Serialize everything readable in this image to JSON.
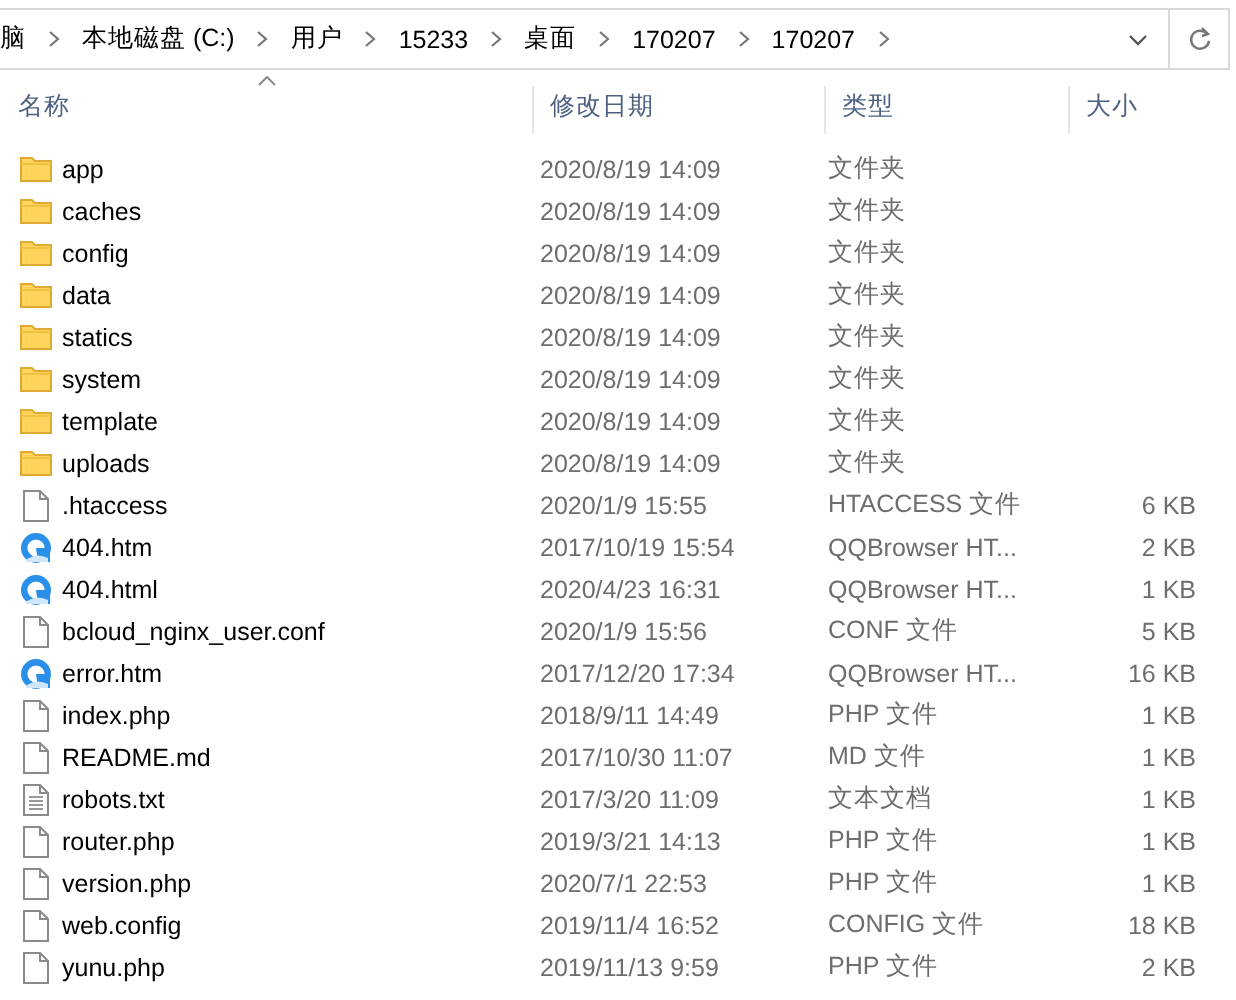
{
  "address_bar": {
    "path": [
      "脑",
      "本地磁盘 (C:)",
      "用户",
      "15233",
      "桌面",
      "170207",
      "170207"
    ]
  },
  "table": {
    "columns": [
      {
        "label": "名称",
        "sorted": true
      },
      {
        "label": "修改日期",
        "sorted": false
      },
      {
        "label": "类型",
        "sorted": false
      },
      {
        "label": "大小",
        "sorted": false
      }
    ],
    "rows": [
      {
        "kind": "folder",
        "name": "app",
        "modified": "2020/8/19 14:09",
        "type": "文件夹"
      },
      {
        "kind": "folder",
        "name": "caches",
        "modified": "2020/8/19 14:09",
        "type": "文件夹"
      },
      {
        "kind": "folder",
        "name": "config",
        "modified": "2020/8/19 14:09",
        "type": "文件夹"
      },
      {
        "kind": "folder",
        "name": "data",
        "modified": "2020/8/19 14:09",
        "type": "文件夹"
      },
      {
        "kind": "folder",
        "name": "statics",
        "modified": "2020/8/19 14:09",
        "type": "文件夹"
      },
      {
        "kind": "folder",
        "name": "system",
        "modified": "2020/8/19 14:09",
        "type": "文件夹"
      },
      {
        "kind": "folder",
        "name": "template",
        "modified": "2020/8/19 14:09",
        "type": "文件夹"
      },
      {
        "kind": "folder",
        "name": "uploads",
        "modified": "2020/8/19 14:09",
        "type": "文件夹"
      },
      {
        "kind": "file",
        "name": ".htaccess",
        "modified": "2020/1/9 15:55",
        "type": "HTACCESS 文件",
        "size": "6 KB"
      },
      {
        "kind": "browser",
        "name": "404.htm",
        "modified": "2017/10/19 15:54",
        "type": "QQBrowser HT...",
        "size": "2 KB"
      },
      {
        "kind": "browser",
        "name": "404.html",
        "modified": "2020/4/23 16:31",
        "type": "QQBrowser HT...",
        "size": "1 KB"
      },
      {
        "kind": "file",
        "name": "bcloud_nginx_user.conf",
        "modified": "2020/1/9 15:56",
        "type": "CONF 文件",
        "size": "5 KB"
      },
      {
        "kind": "browser",
        "name": "error.htm",
        "modified": "2017/12/20 17:34",
        "type": "QQBrowser HT...",
        "size": "16 KB"
      },
      {
        "kind": "file",
        "name": "index.php",
        "modified": "2018/9/11 14:49",
        "type": "PHP 文件",
        "size": "1 KB"
      },
      {
        "kind": "file",
        "name": "README.md",
        "modified": "2017/10/30 11:07",
        "type": "MD 文件",
        "size": "1 KB"
      },
      {
        "kind": "text",
        "name": "robots.txt",
        "modified": "2017/3/20 11:09",
        "type": "文本文档",
        "size": "1 KB"
      },
      {
        "kind": "file",
        "name": "router.php",
        "modified": "2019/3/21 14:13",
        "type": "PHP 文件",
        "size": "1 KB"
      },
      {
        "kind": "file",
        "name": "version.php",
        "modified": "2020/7/1 22:53",
        "type": "PHP 文件",
        "size": "1 KB"
      },
      {
        "kind": "file",
        "name": "web.config",
        "modified": "2019/11/4 16:52",
        "type": "CONFIG 文件",
        "size": "18 KB"
      },
      {
        "kind": "file",
        "name": "yunu.php",
        "modified": "2019/11/13 9:59",
        "type": "PHP 文件",
        "size": "2 KB"
      }
    ]
  }
}
